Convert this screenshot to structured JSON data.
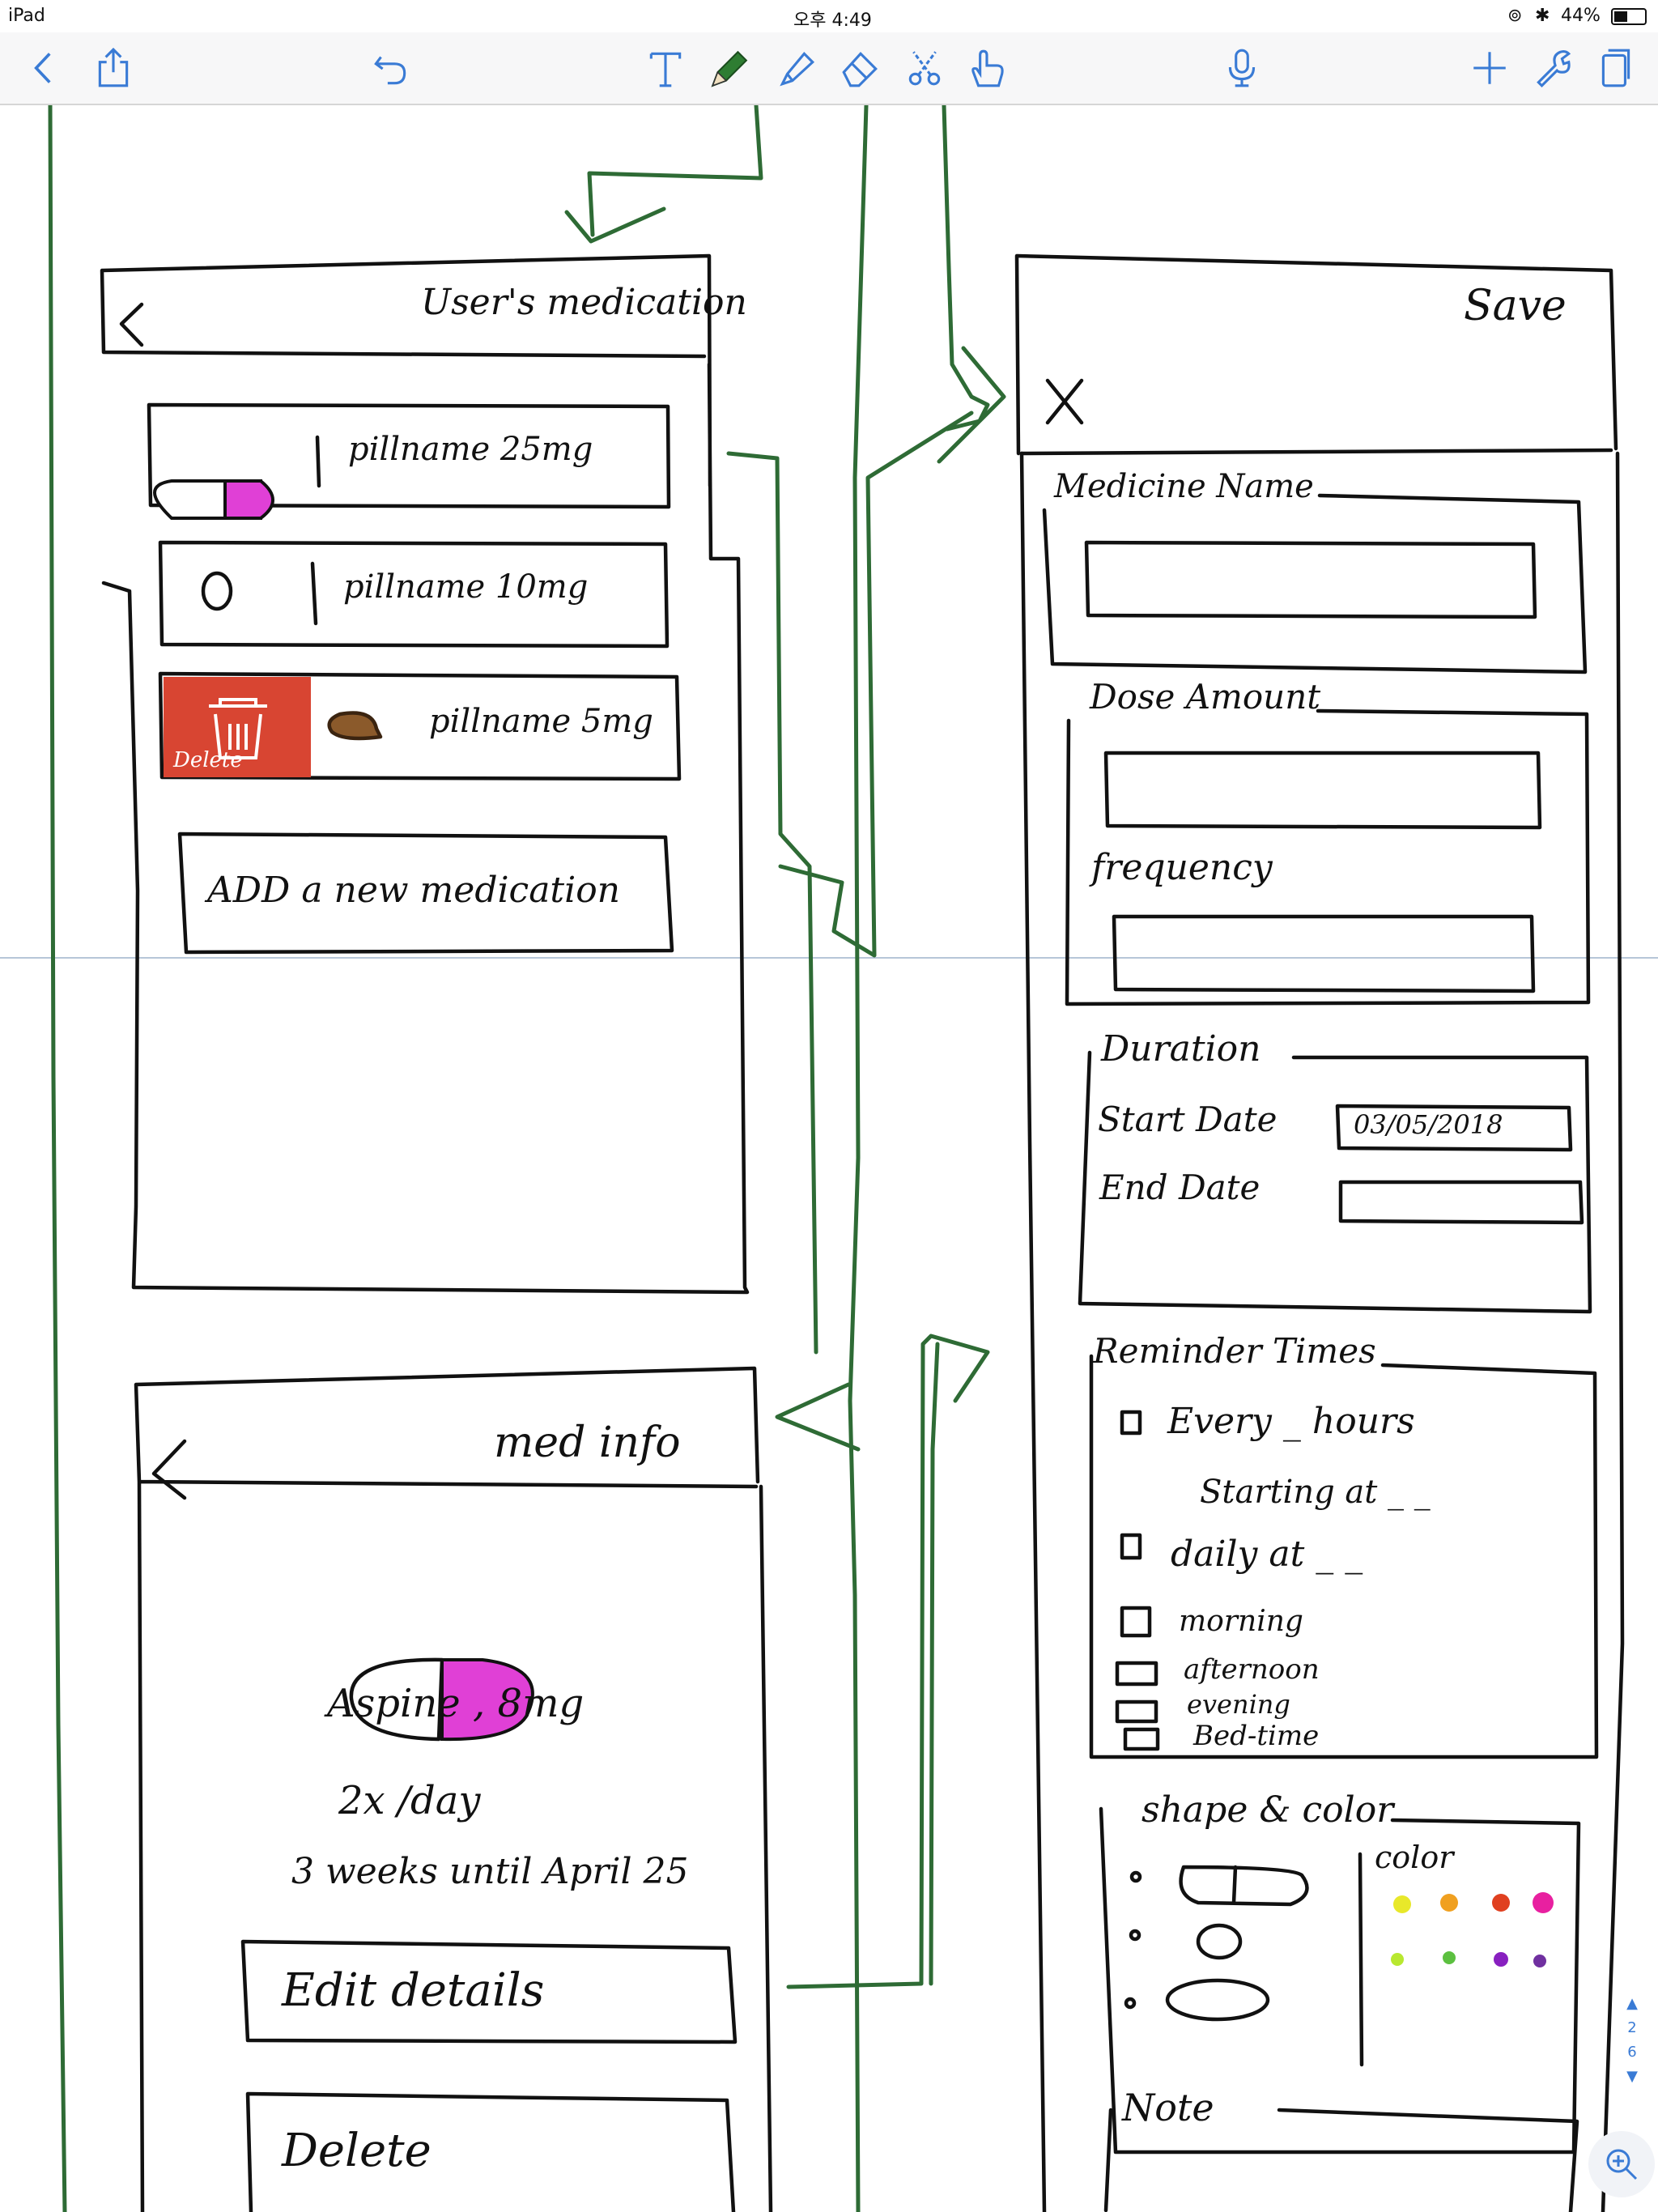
{
  "status_bar": {
    "device": "iPad",
    "time": "오후 4:49",
    "battery": "44%"
  },
  "toolbar": {
    "icons": [
      "back-chevron-icon",
      "share-icon",
      "undo-icon",
      "text-tool-icon",
      "pen-tool-icon",
      "highlighter-tool-icon",
      "eraser-tool-icon",
      "lasso-tool-icon",
      "hand-tool-icon",
      "microphone-icon",
      "add-icon",
      "wrench-icon",
      "pages-icon"
    ],
    "active_tool_color": "#2e7d32"
  },
  "sketch": {
    "list_screen": {
      "title": "User's medication",
      "items": [
        {
          "label": "pillname 25mg",
          "pill_color": "#e040d6"
        },
        {
          "label": "pillname 10mg"
        },
        {
          "label": "pillname 5mg",
          "pill_color": "#8b5a2b"
        }
      ],
      "delete_label": "Delete",
      "delete_color": "#d84532",
      "add_button": "ADD a new medication"
    },
    "info_screen": {
      "title": "med info",
      "name": "Aspine , 8mg",
      "frequency": "2x /day",
      "duration": "3 weeks until April 25",
      "edit_button": "Edit details",
      "delete_button": "Delete"
    },
    "form_screen": {
      "close": "X",
      "save": "Save",
      "medicine_name_label": "Medicine Name",
      "dose_label": "Dose Amount",
      "frequency_label": "frequency",
      "duration_label": "Duration",
      "start_date_label": "Start Date",
      "start_date_value": "03/05/2018",
      "end_date_label": "End Date",
      "reminder_label": "Reminder Times",
      "reminder_every": "Every _ hours",
      "reminder_starting": "Starting at _ _",
      "reminder_daily": "daily at _ _",
      "reminder_options": [
        "morning",
        "afternoon",
        "evening",
        "Bed-time"
      ],
      "shape_color_label": "shape & color",
      "color_label": "color",
      "palette": [
        "#e8e82a",
        "#f0a020",
        "#e04020",
        "#e820a0",
        "#b8e830",
        "#5cc040",
        "#8820c0",
        "#7030a0"
      ],
      "note_label": "Note"
    },
    "flow_color": "#2e6b35"
  },
  "pager": {
    "current": "2",
    "total": "6"
  }
}
